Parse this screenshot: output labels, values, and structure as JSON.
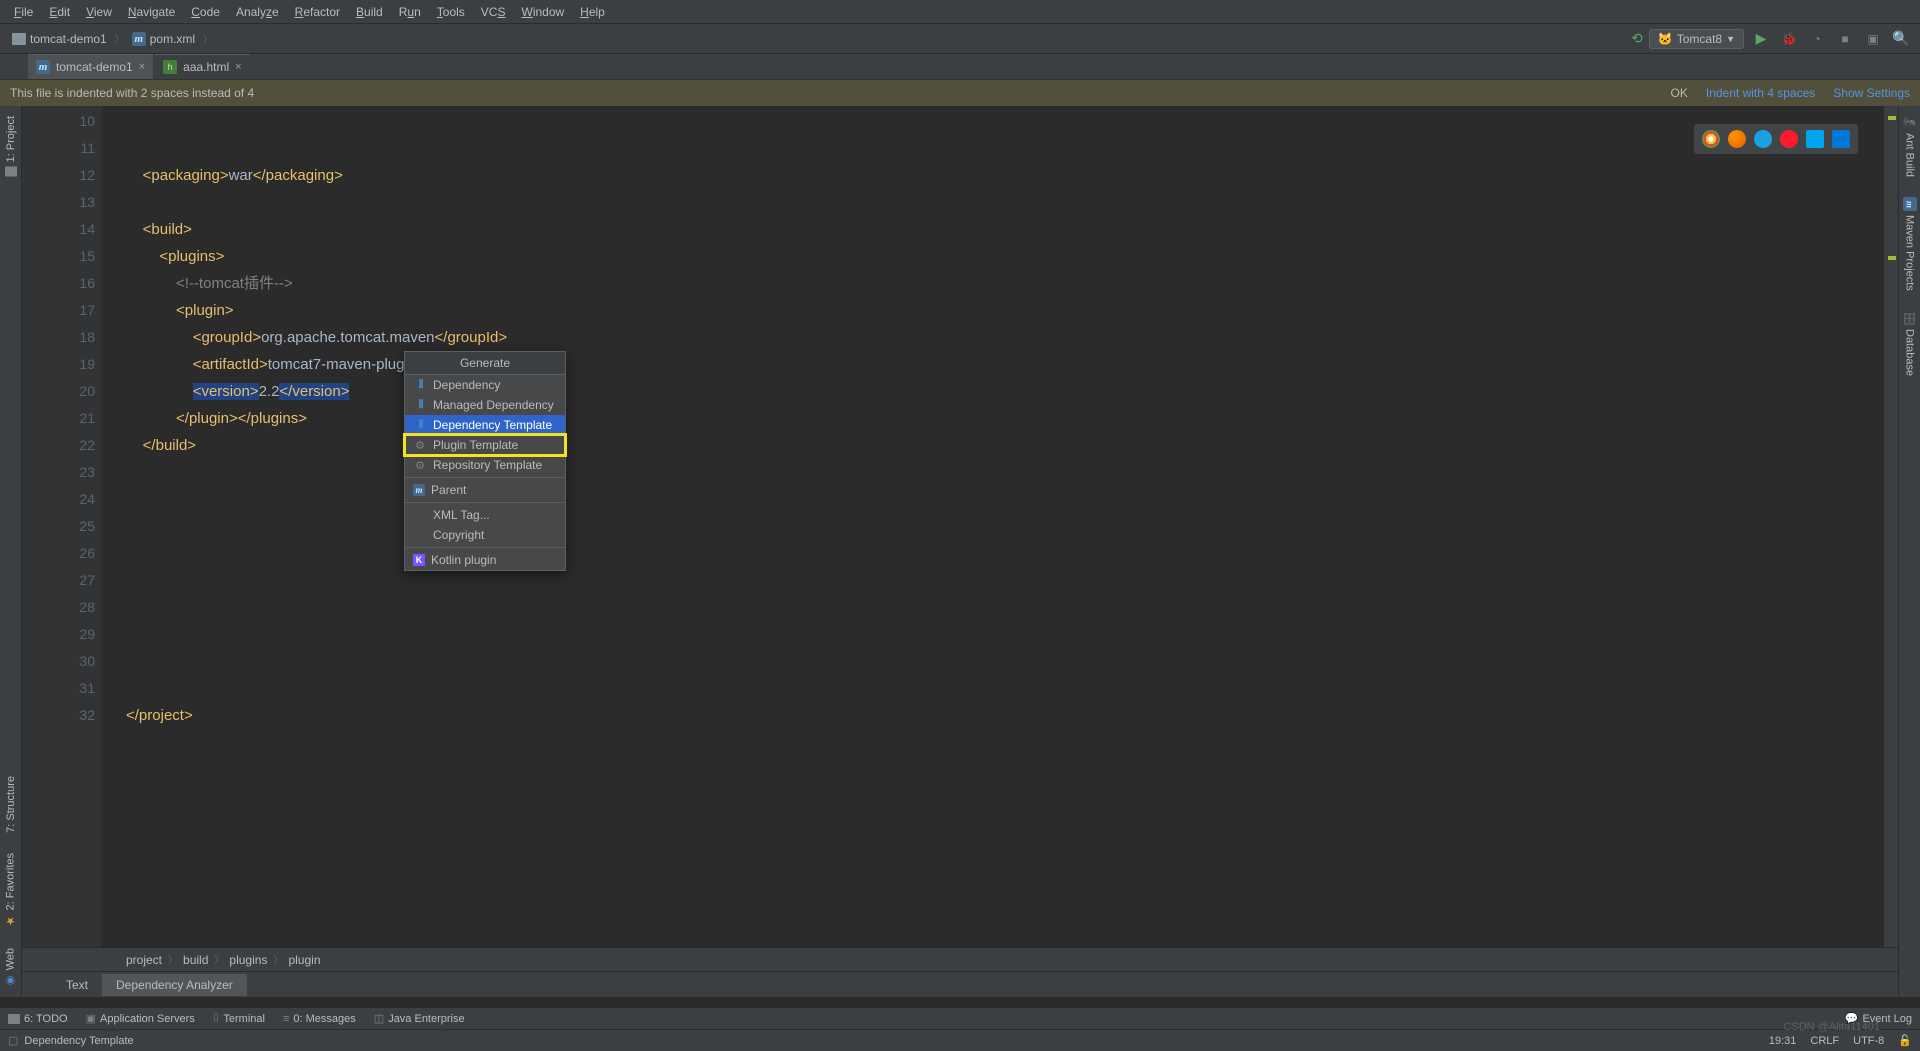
{
  "menu": {
    "items": [
      "File",
      "Edit",
      "View",
      "Navigate",
      "Code",
      "Analyze",
      "Refactor",
      "Build",
      "Run",
      "Tools",
      "VCS",
      "Window",
      "Help"
    ]
  },
  "breadcrumbs": {
    "project": "tomcat-demo1",
    "file": "pom.xml"
  },
  "run": {
    "config": "Tomcat8"
  },
  "tabs": [
    {
      "icon": "m",
      "label": "tomcat-demo1"
    },
    {
      "icon": "html",
      "label": "aaa.html"
    }
  ],
  "notification": {
    "message": "This file is indented with 2 spaces instead of 4",
    "ok": "OK",
    "action1": "Indent with 4 spaces",
    "action2": "Show Settings"
  },
  "lines": {
    "start": 10,
    "count": 23
  },
  "code": {
    "l11_pre": "    ",
    "l11_t1": "<packaging>",
    "l11_tx": "war",
    "l11_t2": "</packaging>",
    "l13_pre": "    ",
    "l13_t": "<build>",
    "l14_pre": "        ",
    "l14_t": "<plugins>",
    "l15_pre": "            ",
    "l15_c": "<!--tomcat插件-->",
    "l16_pre": "            ",
    "l16_t": "<plugin>",
    "l17_pre": "                ",
    "l17_t1": "<groupId>",
    "l17_tx": "org.apache.tomcat.maven",
    "l17_t2": "</groupId>",
    "l18_pre": "                ",
    "l18_t1": "<artifactId>",
    "l18_tx": "tomcat7-maven-plugin",
    "l18_t2": "</artifactId>",
    "l19_pre": "                ",
    "l19_t1": "<version>",
    "l19_tx": "2.2",
    "l19_t2": "</version>",
    "l20_pre": "            ",
    "l20_t1": "</plugin>",
    "l20_t2": "</plugins>",
    "l21_pre": "    ",
    "l21_t": "</build>",
    "l31_t": "</project>"
  },
  "popup": {
    "title": "Generate",
    "items": [
      {
        "label": "Dependency",
        "icon": "bars"
      },
      {
        "label": "Managed Dependency",
        "icon": "bars"
      },
      {
        "label": "Dependency Template",
        "icon": "bars",
        "sel": true
      },
      {
        "label": "Plugin Template",
        "icon": "gear",
        "yellow": true
      },
      {
        "label": "Repository Template",
        "icon": "gear"
      },
      {
        "label": "Parent",
        "icon": "m",
        "sep_before": true
      },
      {
        "label": "XML Tag...",
        "icon": "",
        "sep_before": true
      },
      {
        "label": "Copyright",
        "icon": ""
      },
      {
        "label": "Kotlin plugin",
        "icon": "k",
        "sep_before": true
      }
    ]
  },
  "editor_crumb": [
    "project",
    "build",
    "plugins",
    "plugin"
  ],
  "panel_tabs": {
    "text": "Text",
    "dep": "Dependency Analyzer"
  },
  "left_tools": {
    "project": "1: Project",
    "structure": "7: Structure",
    "favorites": "2: Favorites",
    "web": "Web"
  },
  "right_tools": {
    "ant": "Ant Build",
    "maven": "Maven Projects",
    "database": "Database"
  },
  "bottom_tools": {
    "todo": "6: TODO",
    "app_servers": "Application Servers",
    "terminal": "Terminal",
    "messages": "0: Messages",
    "java_ee": "Java Enterprise",
    "event_log": "Event Log"
  },
  "status": {
    "left": "Dependency Template",
    "pos": "19:31",
    "crlf": "CRLF",
    "enc": "UTF-8",
    "watermark": "CSDN @Alita11401"
  }
}
